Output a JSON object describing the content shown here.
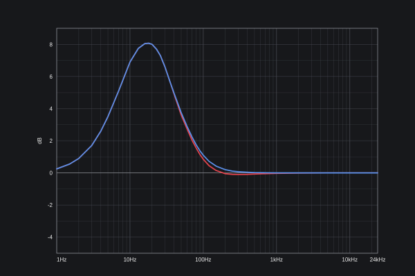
{
  "colors": {
    "background": "#17181b",
    "grid": "#4a4d55",
    "axis": "#8a8d94",
    "text": "#e6e6e6",
    "series_blue": "#5b8fe8",
    "series_red": "#e0434d"
  },
  "chart_data": {
    "type": "line",
    "title": "",
    "xlabel": "",
    "ylabel": "dB",
    "xscale": "log",
    "xlim": [
      1,
      24000
    ],
    "ylim": [
      -5,
      9
    ],
    "grid": true,
    "legend": "none",
    "x_ticks": [
      {
        "value": 1,
        "label": "1Hz"
      },
      {
        "value": 10,
        "label": "10Hz"
      },
      {
        "value": 100,
        "label": "100Hz"
      },
      {
        "value": 1000,
        "label": "1kHz"
      },
      {
        "value": 10000,
        "label": "10kHz"
      },
      {
        "value": 24000,
        "label": "24kHz"
      }
    ],
    "y_ticks": [
      {
        "value": 8,
        "label": "8"
      },
      {
        "value": 6,
        "label": "6"
      },
      {
        "value": 4,
        "label": "4"
      },
      {
        "value": 2,
        "label": "2"
      },
      {
        "value": 0,
        "label": "0"
      },
      {
        "value": -2,
        "label": "-2"
      },
      {
        "value": -4,
        "label": "-4"
      }
    ],
    "series": [
      {
        "color": "#e0434d",
        "x": [
          1,
          1.5,
          2,
          3,
          4,
          5,
          7,
          10,
          13,
          16,
          18,
          20,
          23,
          26,
          30,
          35,
          40,
          50,
          60,
          70,
          80,
          90,
          100,
          120,
          150,
          200,
          250,
          300,
          400,
          500,
          700,
          1000,
          2000,
          5000,
          10000,
          24000
        ],
        "y": [
          0.25,
          0.55,
          0.9,
          1.7,
          2.6,
          3.5,
          5.1,
          6.9,
          7.75,
          8.05,
          8.07,
          8.0,
          7.7,
          7.3,
          6.6,
          5.7,
          4.9,
          3.6,
          2.75,
          2.05,
          1.55,
          1.15,
          0.85,
          0.45,
          0.15,
          -0.05,
          -0.09,
          -0.1,
          -0.09,
          -0.07,
          -0.05,
          -0.03,
          -0.01,
          0.0,
          0.0,
          0.0
        ]
      },
      {
        "color": "#5b8fe8",
        "x": [
          1,
          1.5,
          2,
          3,
          4,
          5,
          7,
          10,
          13,
          16,
          18,
          20,
          23,
          26,
          30,
          35,
          40,
          50,
          60,
          70,
          80,
          90,
          100,
          120,
          150,
          200,
          250,
          300,
          400,
          500,
          700,
          1000,
          2000,
          5000,
          10000,
          24000
        ],
        "y": [
          0.25,
          0.55,
          0.9,
          1.7,
          2.6,
          3.5,
          5.1,
          6.9,
          7.75,
          8.05,
          8.07,
          8.0,
          7.7,
          7.3,
          6.6,
          5.7,
          4.95,
          3.75,
          2.9,
          2.25,
          1.75,
          1.38,
          1.1,
          0.72,
          0.42,
          0.2,
          0.11,
          0.07,
          0.04,
          0.02,
          0.01,
          0.0,
          0.0,
          0.0,
          0.0,
          0.0
        ]
      }
    ]
  }
}
